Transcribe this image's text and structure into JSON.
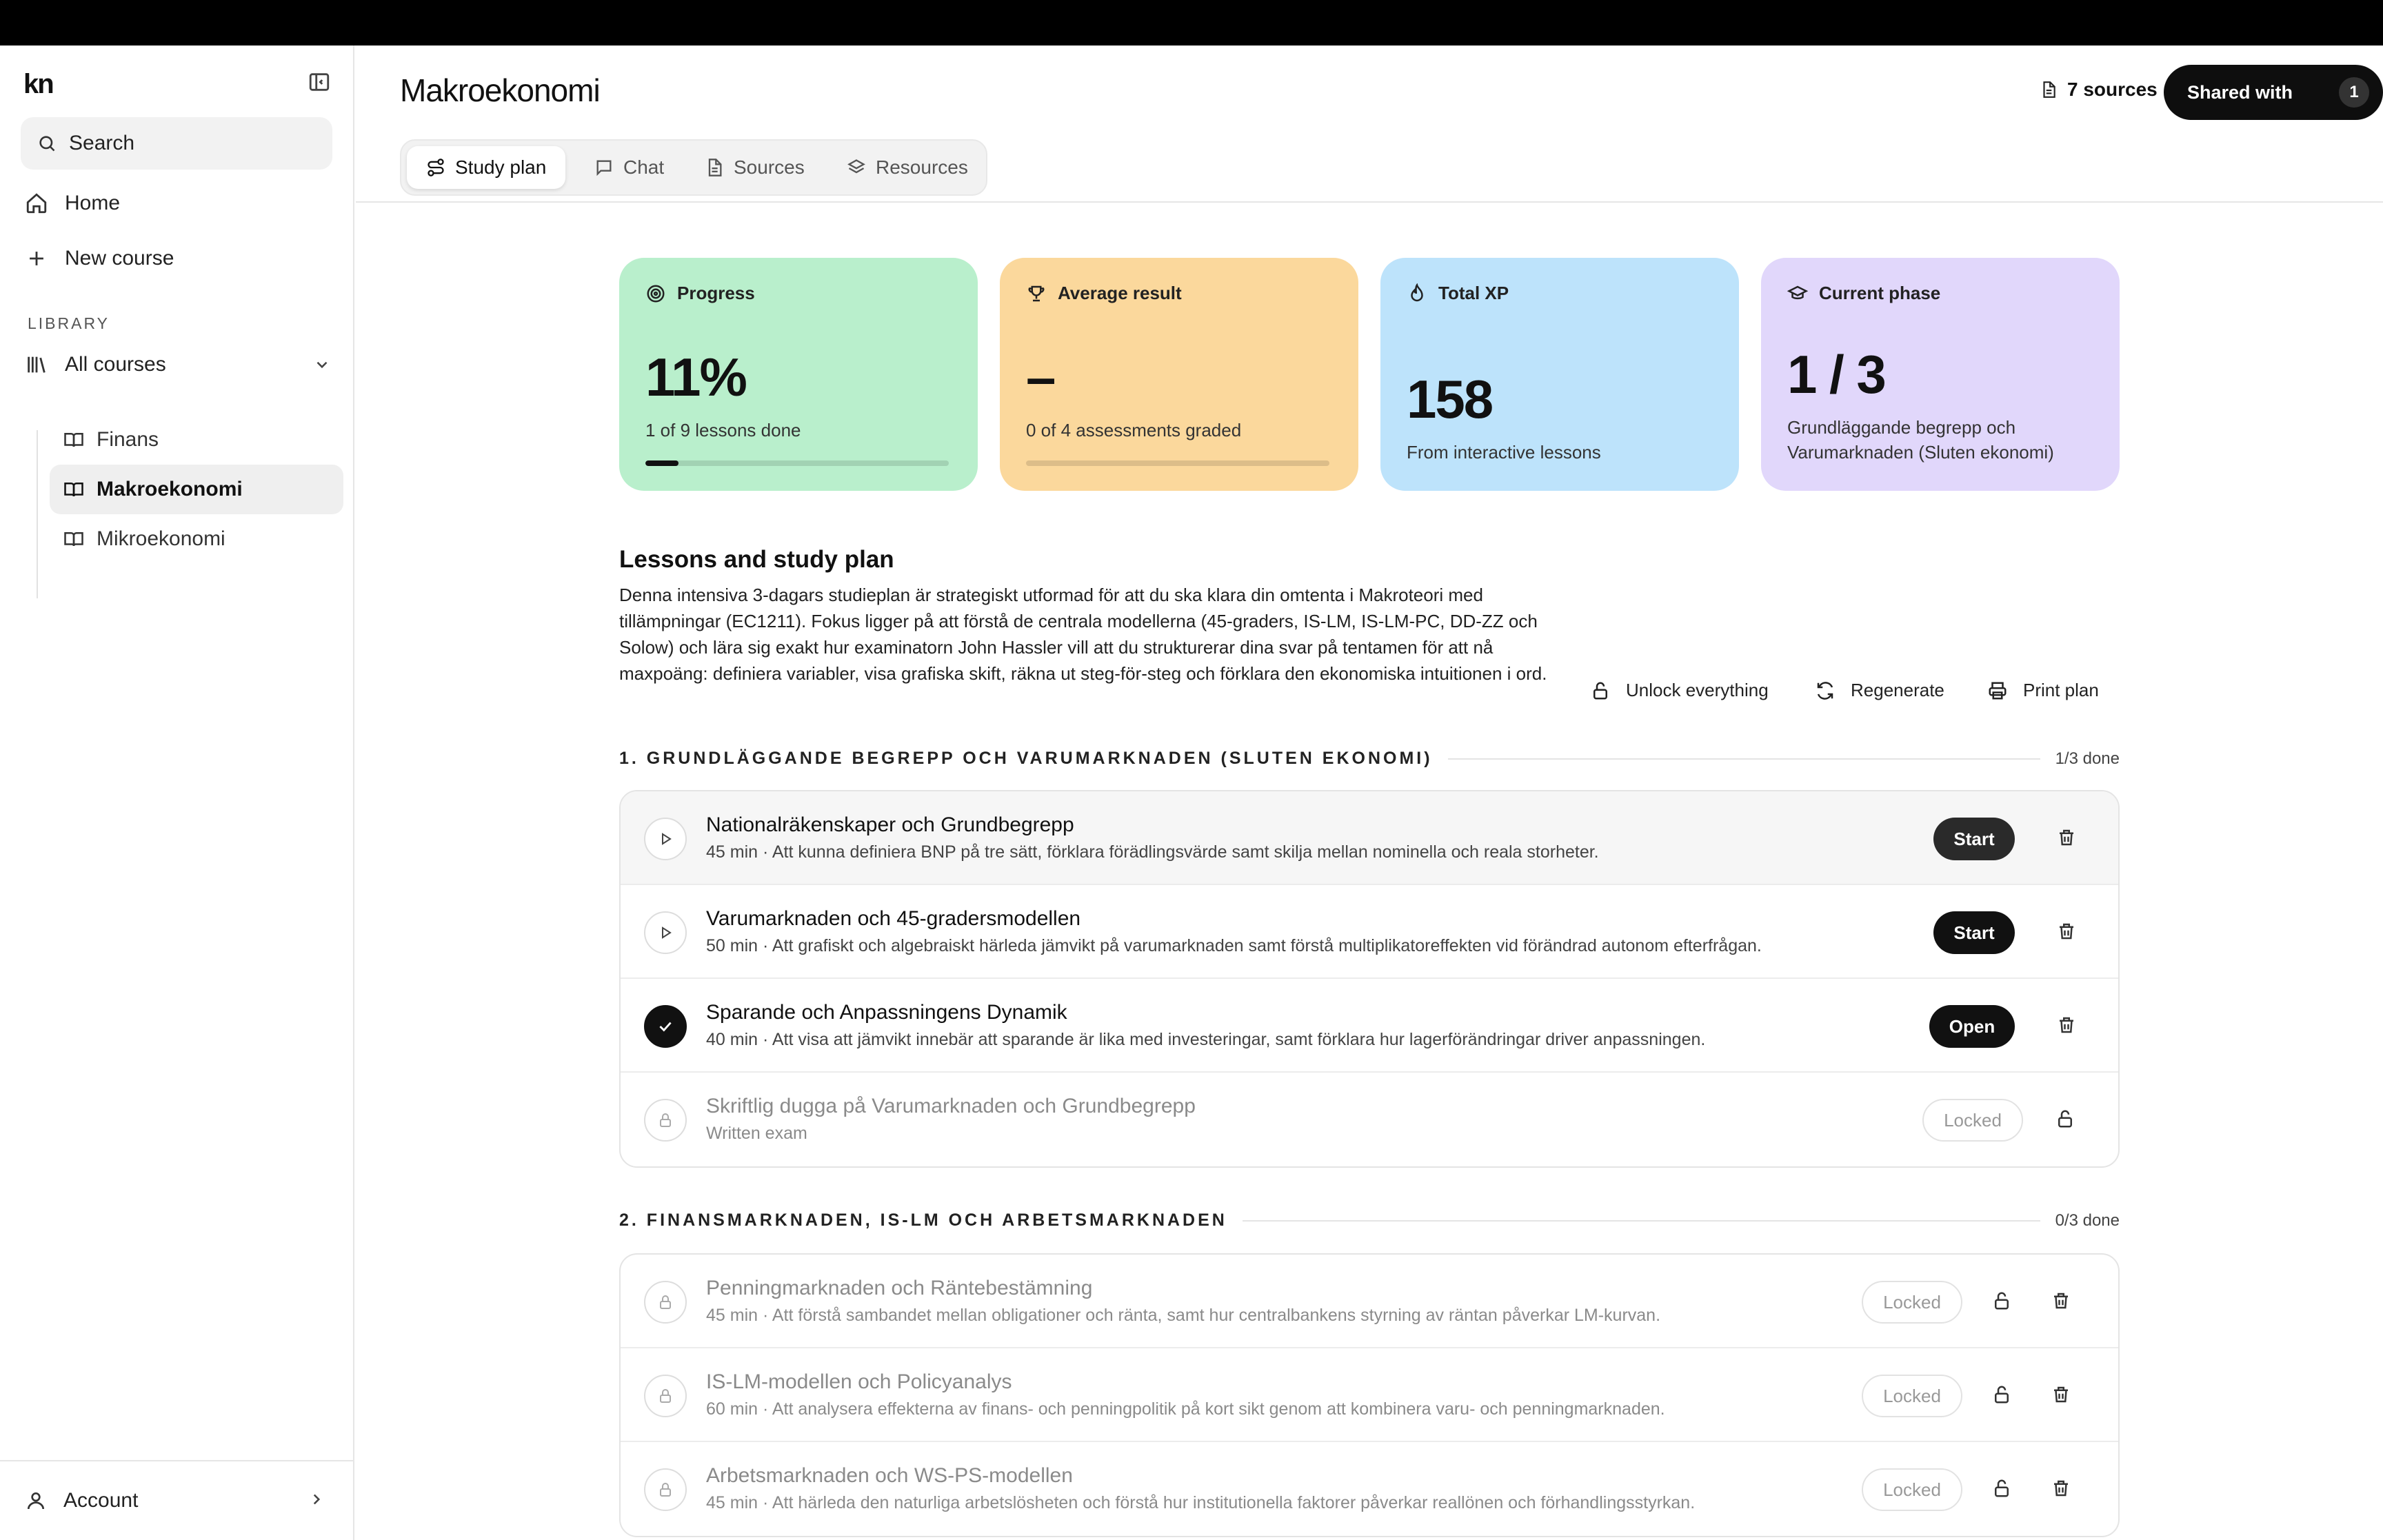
{
  "sidebar": {
    "logo": "kn",
    "search_label": "Search",
    "home_label": "Home",
    "new_course_label": "New course",
    "library_label": "LIBRARY",
    "all_courses_label": "All courses",
    "courses": [
      {
        "label": "Finans"
      },
      {
        "label": "Makroekonomi"
      },
      {
        "label": "Mikroekonomi"
      }
    ],
    "account_label": "Account"
  },
  "header": {
    "title": "Makroekonomi",
    "sources_label": "7 sources",
    "shared_label": "Shared with",
    "shared_count": "1",
    "tabs": [
      {
        "label": "Study plan",
        "icon": "route-icon"
      },
      {
        "label": "Chat",
        "icon": "chat-icon"
      },
      {
        "label": "Sources",
        "icon": "document-icon"
      },
      {
        "label": "Resources",
        "icon": "layers-icon"
      }
    ]
  },
  "stats": {
    "progress": {
      "label": "Progress",
      "value": "11%",
      "sub": "1 of 9 lessons done",
      "fraction": 0.11,
      "color": "#b9efcc"
    },
    "average": {
      "label": "Average result",
      "value": "–",
      "sub": "0 of 4 assessments graded",
      "fraction": 0,
      "color": "#fbd89c"
    },
    "xp": {
      "label": "Total XP",
      "value": "158",
      "sub": "From interactive lessons",
      "color": "#bde3fb"
    },
    "phase": {
      "label": "Current phase",
      "value": "1 / 3",
      "sub_line1": "Grundläggande begrepp och",
      "sub_line2": "Varumarknaden (Sluten ekonomi)",
      "color": "#e1d7fb"
    }
  },
  "lessons_section": {
    "title": "Lessons and study plan",
    "description": "Denna intensiva 3-dagars studieplan är strategiskt utformad för att du ska klara din omtenta i Makroteori med tillämpningar (EC1211). Fokus ligger på att förstå de centrala modellerna (45-graders, IS-LM, IS-LM-PC, DD-ZZ och Solow) och lära sig exakt hur examinatorn John Hassler vill att du strukturerar dina svar på tentamen för att nå maxpoäng: definiera variabler, visa grafiska skift, räkna ut steg-för-steg och förklara den ekonomiska intuitionen i ord.",
    "actions": {
      "unlock": "Unlock everything",
      "regenerate": "Regenerate",
      "print": "Print plan"
    }
  },
  "phases": [
    {
      "heading": "1. GRUNDLÄGGANDE BEGREPP OCH VARUMARKNADEN (SLUTEN EKONOMI)",
      "done": "1/3 done",
      "lessons": [
        {
          "title": "Nationalräkenskaper och Grundbegrepp",
          "meta": "45 min · Att kunna definiera BNP på tre sätt, förklara förädlingsvärde samt skilja mellan nominella och reala storheter.",
          "button": "Start",
          "state": "start"
        },
        {
          "title": "Varumarknaden och 45-gradersmodellen",
          "meta": "50 min · Att grafiskt och algebraiskt härleda jämvikt på varumarknaden samt förstå multiplikatoreffekten vid förändrad autonom efterfrågan.",
          "button": "Start",
          "state": "start"
        },
        {
          "title": "Sparande och Anpassningens Dynamik",
          "meta": "40 min · Att visa att jämvikt innebär att sparande är lika med investeringar, samt förklara hur lagerförändringar driver anpassningen.",
          "button": "Open",
          "state": "done"
        },
        {
          "title": "Skriftlig dugga på Varumarknaden och Grundbegrepp",
          "meta": "Written exam",
          "button": "Locked",
          "state": "locked"
        }
      ]
    },
    {
      "heading": "2. FINANSMARKNADEN, IS-LM OCH ARBETSMARKNADEN",
      "done": "0/3 done",
      "lessons": [
        {
          "title": "Penningmarknaden och Räntebestämning",
          "meta": "45 min · Att förstå sambandet mellan obligationer och ränta, samt hur centralbankens styrning av räntan påverkar LM-kurvan.",
          "button": "Locked",
          "state": "locked"
        },
        {
          "title": "IS-LM-modellen och Policyanalys",
          "meta": "60 min · Att analysera effekterna av finans- och penningpolitik på kort sikt genom att kombinera varu- och penningmarknaden.",
          "button": "Locked",
          "state": "locked"
        },
        {
          "title": "Arbetsmarknaden och WS-PS-modellen",
          "meta": "45 min · Att härleda den naturliga arbetslösheten och förstå hur institutionella faktorer påverkar reallönen och förhandlingsstyrkan.",
          "button": "Locked",
          "state": "locked"
        }
      ]
    }
  ]
}
